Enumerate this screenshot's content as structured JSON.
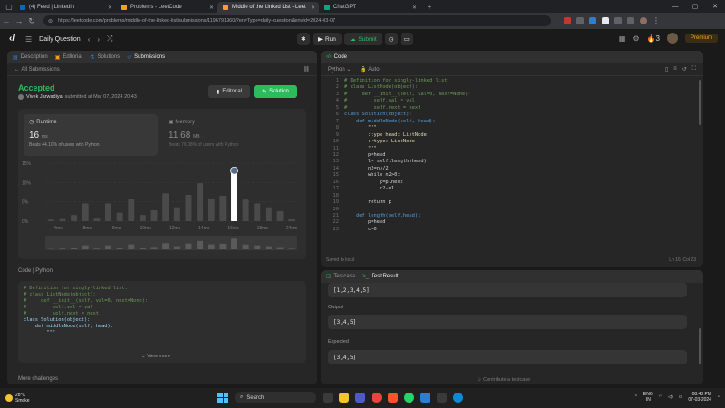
{
  "browser": {
    "tabs": [
      {
        "label": "(4) Feed | LinkedIn",
        "fav_color": "#0a66c2"
      },
      {
        "label": "Problems - LeetCode",
        "fav_color": "#f89f1b"
      },
      {
        "label": "Middle of the Linked List - Leet",
        "fav_color": "#f89f1b"
      },
      {
        "label": "ChatGPT",
        "fav_color": "#10a37f"
      }
    ],
    "url": "https://leetcode.com/problems/middle-of-the-linked-list/submissions/1196791960/?envType=daily-question&envId=2024-03-07"
  },
  "leetcode_top": {
    "title": "Daily Question",
    "run_label": "Run",
    "submit_label": "Submit",
    "streak": "3",
    "premium_label": "Premium"
  },
  "left_panel": {
    "tabs": [
      "Description",
      "Editorial",
      "Solutions",
      "Submissions"
    ],
    "all_submissions": "All Submissions",
    "status": "Accepted",
    "submitter": "Vivek Jarwadiya",
    "submitted_at": "submitted at Mar 07, 2024 20:43",
    "editorial_btn": "Editorial",
    "solution_btn": "Solution",
    "runtime": {
      "label": "Runtime",
      "value": "16",
      "unit": "ms",
      "beats": "Beats 44.10% of users with Python"
    },
    "memory": {
      "label": "Memory",
      "value": "11.68",
      "unit": "MB",
      "beats": "Beats 76.08% of users with Python"
    },
    "code_header": "Code  |  Python",
    "code_preview": [
      "# Definition for singly-linked list.",
      "# class ListNode(object):",
      "#     def __init__(self, val=0, next=None):",
      "#         self.val = val",
      "#         self.next = next",
      "class Solution(object):",
      "    def middleNode(self, head):",
      "        \"\"\""
    ],
    "view_more": "View more",
    "more_challenges": "More challenges"
  },
  "chart_data": {
    "type": "bar",
    "title": "",
    "ylabel": "",
    "y_ticks": [
      "15%",
      "10%",
      "5%",
      "0%"
    ],
    "x_ticks": [
      "4ms",
      "8ms",
      "9ms",
      "10ms",
      "12ms",
      "14ms",
      "16ms",
      "18ms",
      "24ms"
    ],
    "ylim": [
      0,
      15
    ],
    "values": [
      0.4,
      0.8,
      1.6,
      4.6,
      0.9,
      4.6,
      2.2,
      5.8,
      1.6,
      2.8,
      7.2,
      3.6,
      6.8,
      9.8,
      5.8,
      6.6,
      12.6,
      5.6,
      4.6,
      3.6,
      2.6,
      0.6
    ],
    "highlight_index": 16
  },
  "code_panel": {
    "title": "Code",
    "language": "Python",
    "mode": "Auto",
    "saved": "Saved to local",
    "cursor": "Ln 16, Col 23",
    "lines": [
      {
        "n": "1",
        "t": "# Definition for singly-linked list.",
        "c": "com"
      },
      {
        "n": "2",
        "t": "# class ListNode(object):",
        "c": "com"
      },
      {
        "n": "3",
        "t": "#     def __init__(self, val=0, next=None):",
        "c": "com"
      },
      {
        "n": "4",
        "t": "#         self.val = val",
        "c": "com"
      },
      {
        "n": "5",
        "t": "#         self.next = next",
        "c": "com"
      },
      {
        "n": "6",
        "t": "class Solution(object):",
        "c": "kw"
      },
      {
        "n": "7",
        "t": "    def middleNode(self, head):",
        "c": "kw"
      },
      {
        "n": "8",
        "t": "        \"\"\"",
        "c": "txt"
      },
      {
        "n": "9",
        "t": "        :type head: ListNode",
        "c": "txt"
      },
      {
        "n": "10",
        "t": "        :rtype: ListNode",
        "c": "txt"
      },
      {
        "n": "11",
        "t": "        \"\"\"",
        "c": "txt"
      },
      {
        "n": "12",
        "t": "        p=head",
        "c": "plain"
      },
      {
        "n": "13",
        "t": "        l= self.length(head)",
        "c": "plain"
      },
      {
        "n": "14",
        "t": "        n2=n//2",
        "c": "plain"
      },
      {
        "n": "15",
        "t": "        while n2>0:",
        "c": "plain"
      },
      {
        "n": "16",
        "t": "            p=p.next",
        "c": "plain"
      },
      {
        "n": "17",
        "t": "            n2-=1",
        "c": "plain"
      },
      {
        "n": "18",
        "t": "",
        "c": "plain"
      },
      {
        "n": "19",
        "t": "        return p",
        "c": "plain"
      },
      {
        "n": "20",
        "t": "",
        "c": "plain"
      },
      {
        "n": "21",
        "t": "    def length(self,head):",
        "c": "kw"
      },
      {
        "n": "22",
        "t": "        p=head",
        "c": "plain"
      },
      {
        "n": "23",
        "t": "        c=0",
        "c": "plain"
      }
    ]
  },
  "test_panel": {
    "tab_testcase": "Testcase",
    "tab_result": "Test Result",
    "input_value": "[1,2,3,4,5]",
    "output_label": "Output",
    "output_value": "[3,4,5]",
    "expected_label": "Expected",
    "expected_value": "[3,4,5]",
    "contribute": "Contribute a testcase"
  },
  "taskbar": {
    "temp": "28°C",
    "weather": "Smoke",
    "search": "Search",
    "lang": "ENG",
    "region": "IN",
    "time": "08:43 PM",
    "date": "07-03-2024"
  }
}
